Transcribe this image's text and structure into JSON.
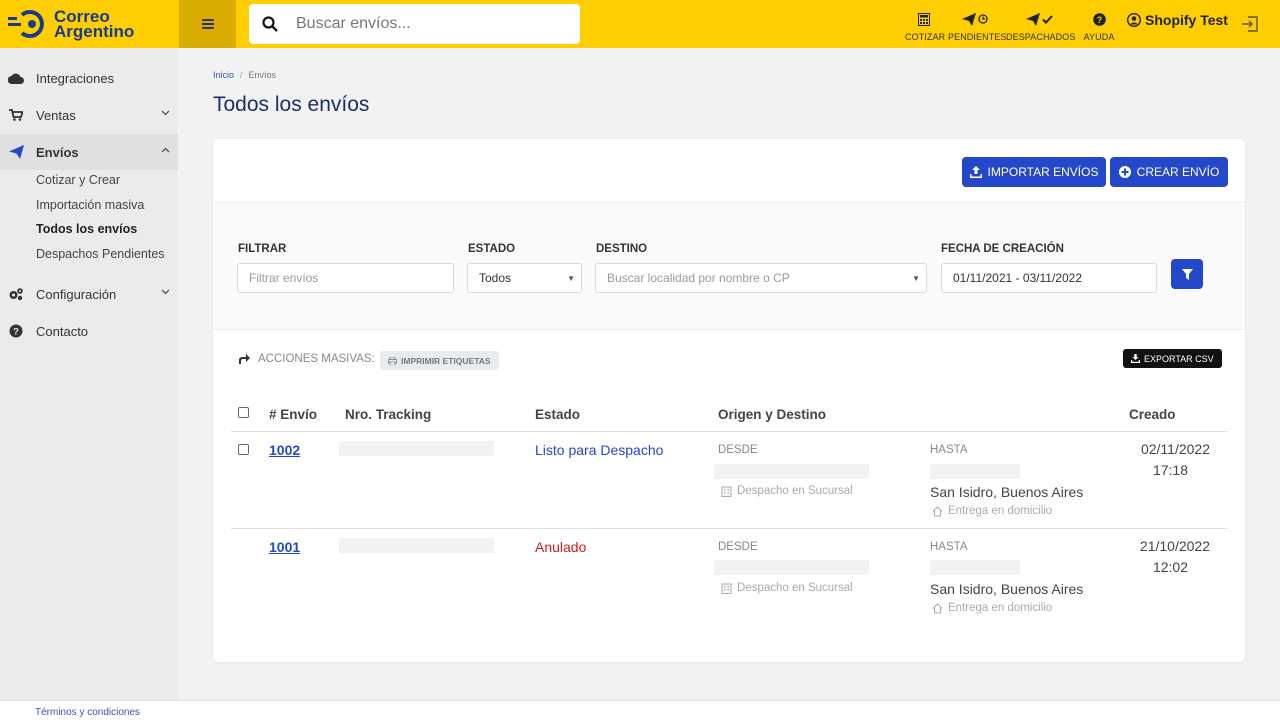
{
  "colors": {
    "brand_yellow": "#ffce00",
    "brand_blue": "#2448c9",
    "title_blue": "#1a2e6a",
    "status_ready": "#2448c9",
    "status_cancelled": "#d11a1a"
  },
  "header": {
    "logo_line1": "Correo",
    "logo_line2": "Argentino",
    "menu_icon": "hamburger-icon",
    "search_placeholder": "Buscar envíos...",
    "nav": [
      {
        "icon": "calculator-icon",
        "label": "COTIZAR"
      },
      {
        "icon": "pending-send-icon",
        "label": "PENDIENTES"
      },
      {
        "icon": "dispatched-icon",
        "label": "DESPACHADOS"
      },
      {
        "icon": "help-icon",
        "label": "AYUDA"
      }
    ],
    "user_name": "Shopify Test",
    "logout_icon": "logout-icon"
  },
  "sidebar": {
    "items": [
      {
        "label": "Integraciones",
        "icon": "cloud-icon"
      },
      {
        "label": "Ventas",
        "icon": "cart-icon"
      },
      {
        "label": "Envíos",
        "icon": "paper-plane-icon"
      },
      {
        "label": "Configuración",
        "icon": "gears-icon"
      },
      {
        "label": "Contacto",
        "icon": "question-circle-icon"
      }
    ],
    "sub_items": [
      "Cotizar y Crear",
      "Importación masiva",
      "Todos los envíos",
      "Despachos Pendientes"
    ]
  },
  "breadcrumb": {
    "home": "Inicio",
    "separator": "/",
    "current": "Envíos"
  },
  "page_title": "Todos los envíos",
  "actions": {
    "import_label": "IMPORTAR ENVÍOS",
    "create_label": "CREAR ENVÍO"
  },
  "filters": {
    "filter_label": "FILTRAR",
    "filter_placeholder": "Filtrar envíos",
    "estado_label": "ESTADO",
    "estado_value": "Todos",
    "destino_label": "DESTINO",
    "destino_placeholder": "Buscar localidad por nombre o CP",
    "fecha_label": "FECHA DE CREACIÓN",
    "fecha_value": "01/11/2021 - 03/11/2022"
  },
  "mass_actions": {
    "label": "ACCIONES MASIVAS:",
    "print_label": "IMPRIMIR ETIQUETAS",
    "export_label": "EXPORTAR CSV"
  },
  "table": {
    "headers": [
      "# Envío",
      "Nro. Tracking",
      "Estado",
      "Origen y Destino",
      "Creado"
    ],
    "rows": [
      {
        "id": "1002",
        "estado": "Listo para Despacho",
        "desde": "DESDE",
        "origen_tipo": "Despacho en Sucursal",
        "hasta": "HASTA",
        "destino": "San Isidro, Buenos Aires",
        "destino_tipo": "Entrega en domicilio",
        "fecha": "02/11/2022",
        "hora": "17:18"
      },
      {
        "id": "1001",
        "estado": "Anulado",
        "desde": "DESDE",
        "origen_tipo": "Despacho en Sucursal",
        "hasta": "HASTA",
        "destino": "San Isidro, Buenos Aires",
        "destino_tipo": "Entrega en domicilio",
        "fecha": "21/10/2022",
        "hora": "12:02"
      }
    ]
  },
  "footer": {
    "terms": "Términos y condiciones"
  }
}
